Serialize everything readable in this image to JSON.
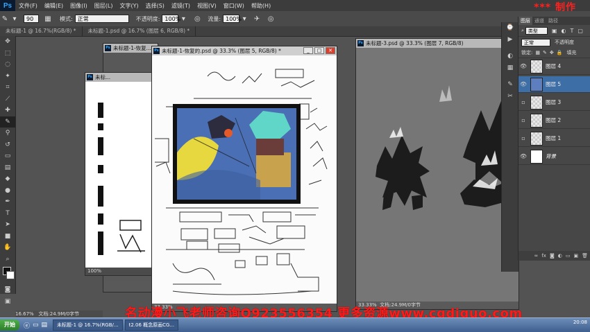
{
  "app": {
    "logo": "Ps"
  },
  "menu": [
    "文件(F)",
    "编辑(E)",
    "图像(I)",
    "图层(L)",
    "文字(Y)",
    "选择(S)",
    "滤镜(T)",
    "视图(V)",
    "窗口(W)",
    "帮助(H)"
  ],
  "watermark_top": "*** 制作",
  "options": {
    "brush_size": "90",
    "mode_label": "模式:",
    "mode_value": "正常",
    "opacity_label": "不透明度:",
    "opacity_value": "100%",
    "flow_label": "流量:",
    "flow_value": "100%"
  },
  "tabs": [
    "未标题-1 @ 16.7%(RGB/8) *",
    "未标题-1.psd @ 16.7% (图层 6, RGB/8) *"
  ],
  "windows": {
    "left_back": {
      "title": "未标题-1-恢复...",
      "status": "100%"
    },
    "left_mid": {
      "title": "未标...",
      "zoom": "100%",
      "status": "16.67%"
    },
    "center": {
      "title": "未标题-1-恢复的.psd @ 33.3% (图层 5, RGB/8) *",
      "zoom": "33.33%"
    },
    "right": {
      "title": "未标题-3.psd @ 33.3% (图层 7, RGB/8)",
      "zoom": "33.33%",
      "status": "文档:24.9M/0字节"
    }
  },
  "status_bottom_left": {
    "zoom": "16.67%",
    "doc": "文档:24.9M/0字节"
  },
  "layers_panel": {
    "tabs": [
      "图层",
      "通道",
      "路径"
    ],
    "kind_label": "类型",
    "blend_mode": "正常",
    "opacity_label": "不透明度",
    "lock_label": "锁定:",
    "fill_label": "填充",
    "layers": [
      {
        "name": "图层 4",
        "visible": true,
        "selected": false
      },
      {
        "name": "图层 5",
        "visible": true,
        "selected": true
      },
      {
        "name": "图层 3",
        "visible": false,
        "selected": false
      },
      {
        "name": "图层 2",
        "visible": false,
        "selected": false
      },
      {
        "name": "图层 1",
        "visible": false,
        "selected": false
      },
      {
        "name": "背景",
        "visible": true,
        "selected": false
      }
    ]
  },
  "taskbar": {
    "start": "开始",
    "buttons": [
      "未标题-1 @ 16.7%(RGB/...",
      "t2.06 概念原画CG..."
    ],
    "clock": "20:08"
  },
  "bottom_watermark": "名动漫小飞老师咨询Q923556354 更多资源www.cgdiguo.com",
  "colors": {
    "accent": "#31a8ff",
    "selected_layer": "#3d6ea6",
    "watermark": "#ff1a1a"
  }
}
